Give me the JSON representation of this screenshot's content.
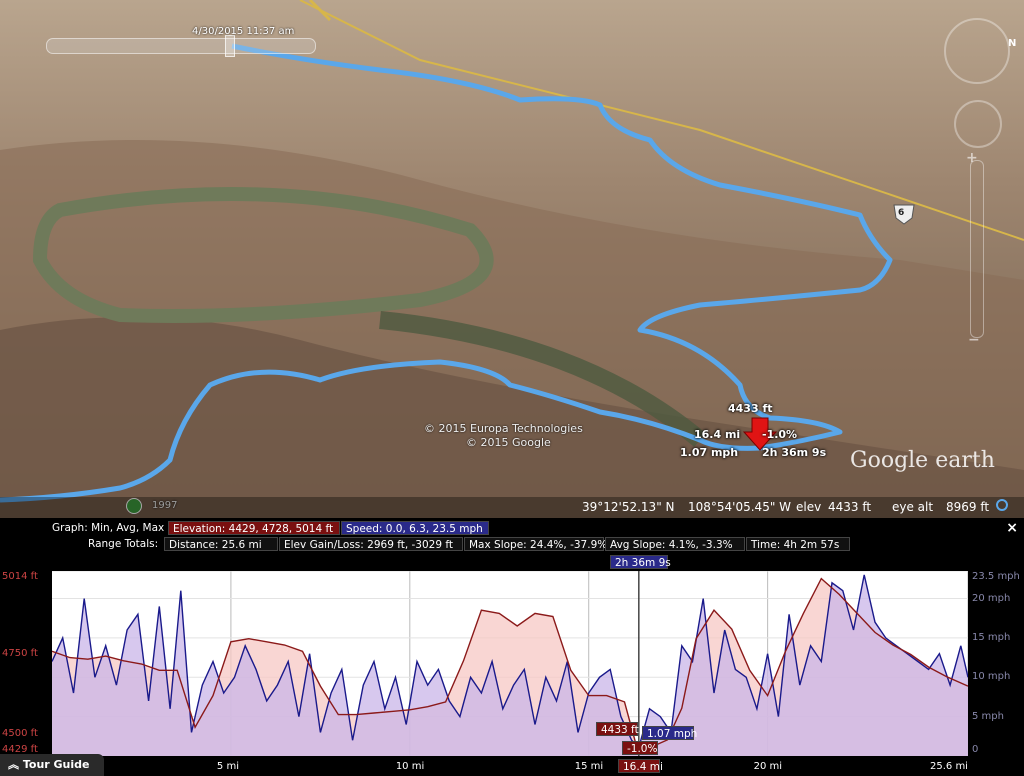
{
  "map": {
    "timestamp": "4/30/2015  11:37 am",
    "route_label_6": "6",
    "marker": {
      "elevation": "4433 ft",
      "distance": "16.4 mi",
      "slope": "-1.0%",
      "speed": "1.07 mph",
      "time": "2h 36m 9s"
    },
    "credits": [
      "© 2015 Europa Technologies",
      "© 2015 Google"
    ],
    "logo": "Google earth",
    "historical_year": "1997",
    "compass_letter": "N"
  },
  "statusbar": {
    "lat": "39°12'52.13\" N",
    "lon": "108°54'05.45\" W",
    "elev_label": "elev",
    "elev": "4433 ft",
    "eye_label": "eye alt",
    "eye": "8969 ft"
  },
  "profile": {
    "graph_label": "Graph: Min, Avg, Max",
    "elevation_stat": "Elevation: 4429, 4728, 5014 ft",
    "speed_stat": "Speed: 0.0, 6.3, 23.5 mph",
    "range_label": "Range Totals:",
    "distance": "Distance: 25.6 mi",
    "gain_loss": "Elev Gain/Loss: 2969 ft, -3029 ft",
    "max_slope": "Max Slope: 24.4%, -37.9%",
    "avg_slope": "Avg Slope: 4.1%, -3.3%",
    "time": "Time: 4h 2m 57s",
    "cursor_time": "2h 36m 9s",
    "cursor_elev": "4433 ft",
    "cursor_speed": "1.07 mph",
    "cursor_slope": "-1.0%",
    "cursor_distance": "16.4 mi",
    "close_label": "×",
    "tour_guide": "Tour Guide"
  },
  "chart_data": {
    "type": "area",
    "xlim": [
      0,
      25.6
    ],
    "x_ticks": [
      {
        "value": 5,
        "label": "5 mi"
      },
      {
        "value": 10,
        "label": "10 mi"
      },
      {
        "value": 15,
        "label": "15 mi"
      },
      {
        "value": 20,
        "label": "20 mi"
      },
      {
        "value": 25.6,
        "label": "25.6 mi"
      }
    ],
    "y_left": {
      "min": 4429,
      "max": 5014,
      "ticks": [
        {
          "value": 5014,
          "label": "5014 ft"
        },
        {
          "value": 4750,
          "label": "4750 ft"
        },
        {
          "value": 4500,
          "label": "4500 ft"
        },
        {
          "value": 4429,
          "label": "4429 ft"
        }
      ]
    },
    "y_right": {
      "min": 0,
      "max": 23.5,
      "ticks": [
        {
          "value": 23.5,
          "label": "23.5 mph"
        },
        {
          "value": 20,
          "label": "20 mph"
        },
        {
          "value": 15,
          "label": "15 mph"
        },
        {
          "value": 10,
          "label": "10 mph"
        },
        {
          "value": 5,
          "label": "5 mph"
        },
        {
          "value": 0,
          "label": "0"
        }
      ]
    },
    "cursor_x": 16.4,
    "series": [
      {
        "name": "Elevation",
        "color": "#8b1a1a",
        "fill": "#f7c8c4",
        "x": [
          0,
          0.5,
          1,
          1.5,
          2,
          2.5,
          3,
          3.5,
          4,
          4.5,
          5,
          5.5,
          6,
          6.5,
          7,
          7.5,
          8,
          8.5,
          9,
          9.5,
          10,
          10.5,
          11,
          11.5,
          12,
          12.5,
          13,
          13.5,
          14,
          14.5,
          15,
          15.5,
          16,
          16.4,
          16.8,
          17.2,
          17.6,
          18,
          18.5,
          19,
          19.5,
          20,
          20.5,
          21,
          21.5,
          22,
          22.5,
          23,
          23.5,
          24,
          24.5,
          25,
          25.6
        ],
        "values": [
          4760,
          4740,
          4735,
          4745,
          4730,
          4720,
          4700,
          4700,
          4520,
          4620,
          4790,
          4800,
          4790,
          4780,
          4760,
          4650,
          4560,
          4560,
          4565,
          4570,
          4575,
          4585,
          4600,
          4730,
          4890,
          4880,
          4840,
          4880,
          4870,
          4700,
          4620,
          4620,
          4600,
          4433,
          4460,
          4480,
          4580,
          4800,
          4890,
          4830,
          4700,
          4620,
          4760,
          4880,
          4990,
          4940,
          4880,
          4820,
          4780,
          4750,
          4710,
          4680,
          4650
        ]
      },
      {
        "name": "Speed",
        "color": "#1a1a8b",
        "fill": "#c9b6e8",
        "x": [
          0,
          0.3,
          0.6,
          0.9,
          1.2,
          1.5,
          1.8,
          2.1,
          2.4,
          2.7,
          3,
          3.3,
          3.6,
          3.9,
          4.2,
          4.5,
          4.8,
          5.1,
          5.4,
          5.7,
          6,
          6.3,
          6.6,
          6.9,
          7.2,
          7.5,
          7.8,
          8.1,
          8.4,
          8.7,
          9,
          9.3,
          9.6,
          9.9,
          10.2,
          10.5,
          10.8,
          11.1,
          11.4,
          11.7,
          12,
          12.3,
          12.6,
          12.9,
          13.2,
          13.5,
          13.8,
          14.1,
          14.4,
          14.7,
          15,
          15.3,
          15.6,
          15.9,
          16.2,
          16.4,
          16.7,
          17,
          17.3,
          17.6,
          17.9,
          18.2,
          18.5,
          18.8,
          19.1,
          19.4,
          19.7,
          20,
          20.3,
          20.6,
          20.9,
          21.2,
          21.5,
          21.8,
          22.1,
          22.4,
          22.7,
          23,
          23.3,
          23.6,
          23.9,
          24.2,
          24.5,
          24.8,
          25.1,
          25.4,
          25.6
        ],
        "values": [
          12,
          15,
          8,
          20,
          10,
          14,
          9,
          16,
          18,
          7,
          19,
          6,
          21,
          3,
          9,
          12,
          8,
          10,
          14,
          11,
          7,
          9,
          12,
          5,
          13,
          3,
          8,
          11,
          2,
          9,
          12,
          6,
          10,
          4,
          12,
          9,
          11,
          7,
          5,
          10,
          8,
          12,
          6,
          9,
          11,
          4,
          10,
          7,
          12,
          3,
          8,
          10,
          11,
          5,
          2,
          1.07,
          6,
          5,
          3,
          14,
          12,
          20,
          8,
          16,
          11,
          10,
          6,
          13,
          5,
          18,
          9,
          14,
          12,
          22,
          21,
          16,
          23,
          17,
          15,
          14,
          13,
          12,
          11,
          13,
          9,
          14,
          10
        ]
      }
    ]
  }
}
